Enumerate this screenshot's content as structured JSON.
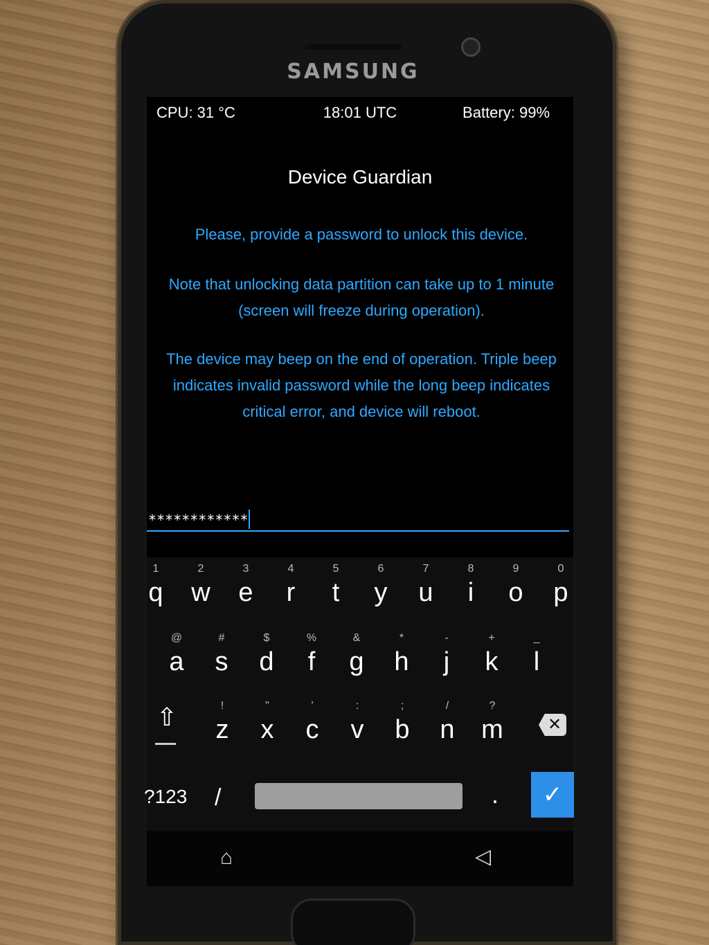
{
  "device": {
    "brand": "SAMSUNG"
  },
  "status_bar": {
    "cpu": "CPU: 31 °C",
    "time": "18:01 UTC",
    "battery": "Battery: 99%"
  },
  "app": {
    "title": "Device Guardian",
    "message_1": "Please, provide a password to unlock this device.",
    "message_2": "Note that unlocking data partition can take up to 1 minute (screen will freeze during operation).",
    "message_3": "The device may beep on the end of operation. Triple beep indicates invalid password while the long beep indicates critical error, and device will reboot.",
    "password_value": "************"
  },
  "keyboard": {
    "row1": [
      {
        "ch": "q",
        "hint": "1"
      },
      {
        "ch": "w",
        "hint": "2"
      },
      {
        "ch": "e",
        "hint": "3"
      },
      {
        "ch": "r",
        "hint": "4"
      },
      {
        "ch": "t",
        "hint": "5"
      },
      {
        "ch": "y",
        "hint": "6"
      },
      {
        "ch": "u",
        "hint": "7"
      },
      {
        "ch": "i",
        "hint": "8"
      },
      {
        "ch": "o",
        "hint": "9"
      },
      {
        "ch": "p",
        "hint": "0"
      }
    ],
    "row2": [
      {
        "ch": "a",
        "hint": "@"
      },
      {
        "ch": "s",
        "hint": "#"
      },
      {
        "ch": "d",
        "hint": "$"
      },
      {
        "ch": "f",
        "hint": "%"
      },
      {
        "ch": "g",
        "hint": "&"
      },
      {
        "ch": "h",
        "hint": "*"
      },
      {
        "ch": "j",
        "hint": "-"
      },
      {
        "ch": "k",
        "hint": "+"
      },
      {
        "ch": "l",
        "hint": "_"
      }
    ],
    "row3": [
      {
        "ch": "z",
        "hint": "!"
      },
      {
        "ch": "x",
        "hint": "\""
      },
      {
        "ch": "c",
        "hint": "'"
      },
      {
        "ch": "v",
        "hint": ":"
      },
      {
        "ch": "b",
        "hint": ";"
      },
      {
        "ch": "n",
        "hint": "/"
      },
      {
        "ch": "m",
        "hint": "?"
      }
    ],
    "symbols_label": "?123",
    "slash_label": "/",
    "period_label": ".",
    "shift_icon": "⇧",
    "backspace_icon": "✕",
    "enter_icon": "✓"
  },
  "nav_bar": {
    "home_icon": "⌂",
    "back_icon": "◁"
  }
}
